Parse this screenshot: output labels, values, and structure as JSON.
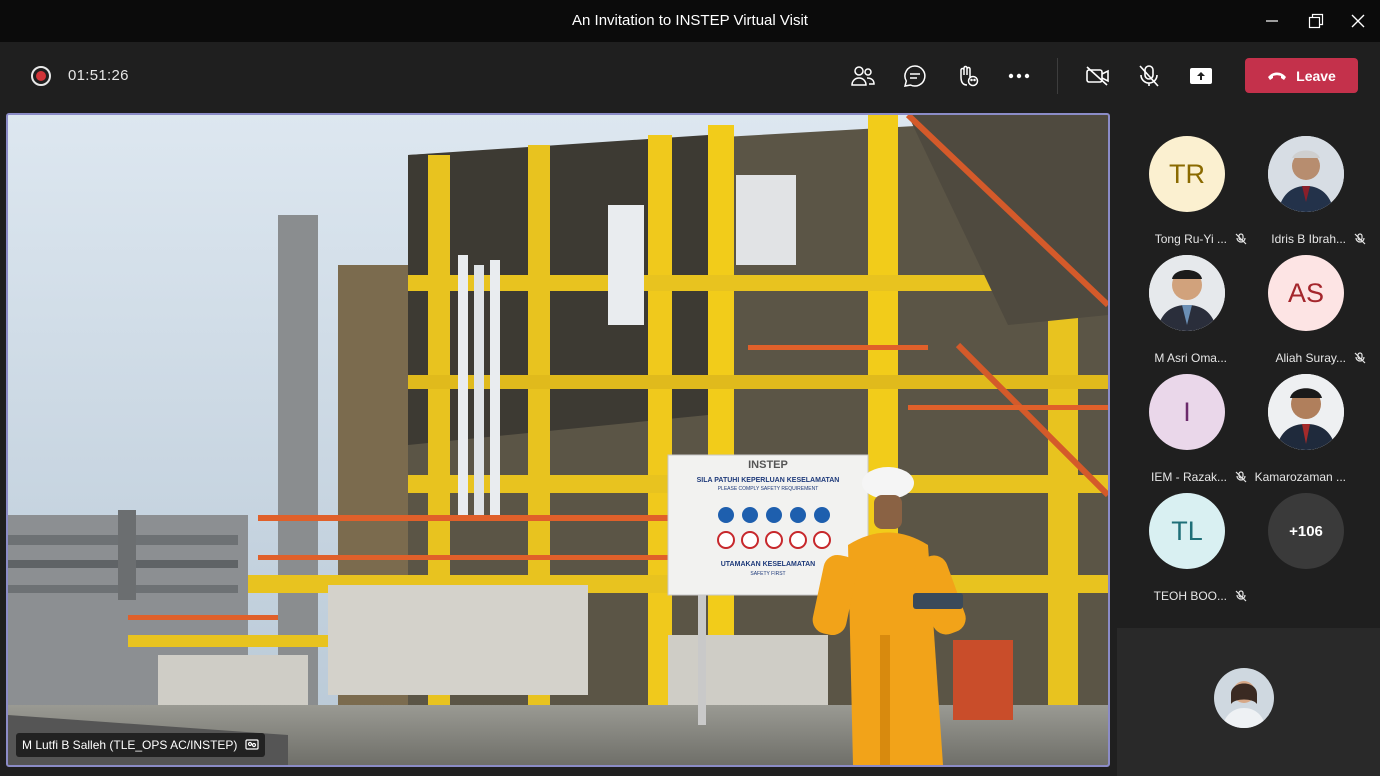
{
  "window": {
    "title": "An Invitation to INSTEP Virtual Visit"
  },
  "toolbar": {
    "timer": "01:51:26",
    "leave_label": "Leave",
    "colors": {
      "leave": "#c4314b",
      "recording": "#d13438",
      "active_border": "#8b8cc7"
    }
  },
  "stage": {
    "speaker_name": "M Lutfi B Salleh (TLE_OPS AC/INSTEP)",
    "sign": {
      "logo": "INSTEP",
      "heading": "SILA PATUHI KEPERLUAN KESELAMATAN",
      "subheading": "PLEASE COMPLY SAFETY REQUIREMENT",
      "footer": "UTAMAKAN KESELAMATAN",
      "footer_sub": "SAFETY FIRST"
    }
  },
  "participants": [
    {
      "initials": "TR",
      "name": "Tong Ru-Yi ...",
      "muted": true,
      "avatar_bg": "#fbf0d0",
      "avatar_fg": "#8a6a00"
    },
    {
      "initials": "",
      "name": "Idris B Ibrah...",
      "muted": true,
      "photo": true
    },
    {
      "initials": "",
      "name": "M Asri Oma...",
      "muted": false,
      "photo": true
    },
    {
      "initials": "AS",
      "name": "Aliah Suray...",
      "muted": true,
      "avatar_bg": "#fde4e4",
      "avatar_fg": "#a4262c"
    },
    {
      "initials": "I",
      "name": "IEM - Razak...",
      "muted": true,
      "avatar_bg": "#ead7ea",
      "avatar_fg": "#6b2a6b"
    },
    {
      "initials": "",
      "name": "Kamarozaman ...",
      "muted": false,
      "photo": true
    },
    {
      "initials": "TL",
      "name": "TEOH BOO...",
      "muted": true,
      "avatar_bg": "#d9f0f2",
      "avatar_fg": "#1f6f78"
    }
  ],
  "overflow_count": "+106"
}
